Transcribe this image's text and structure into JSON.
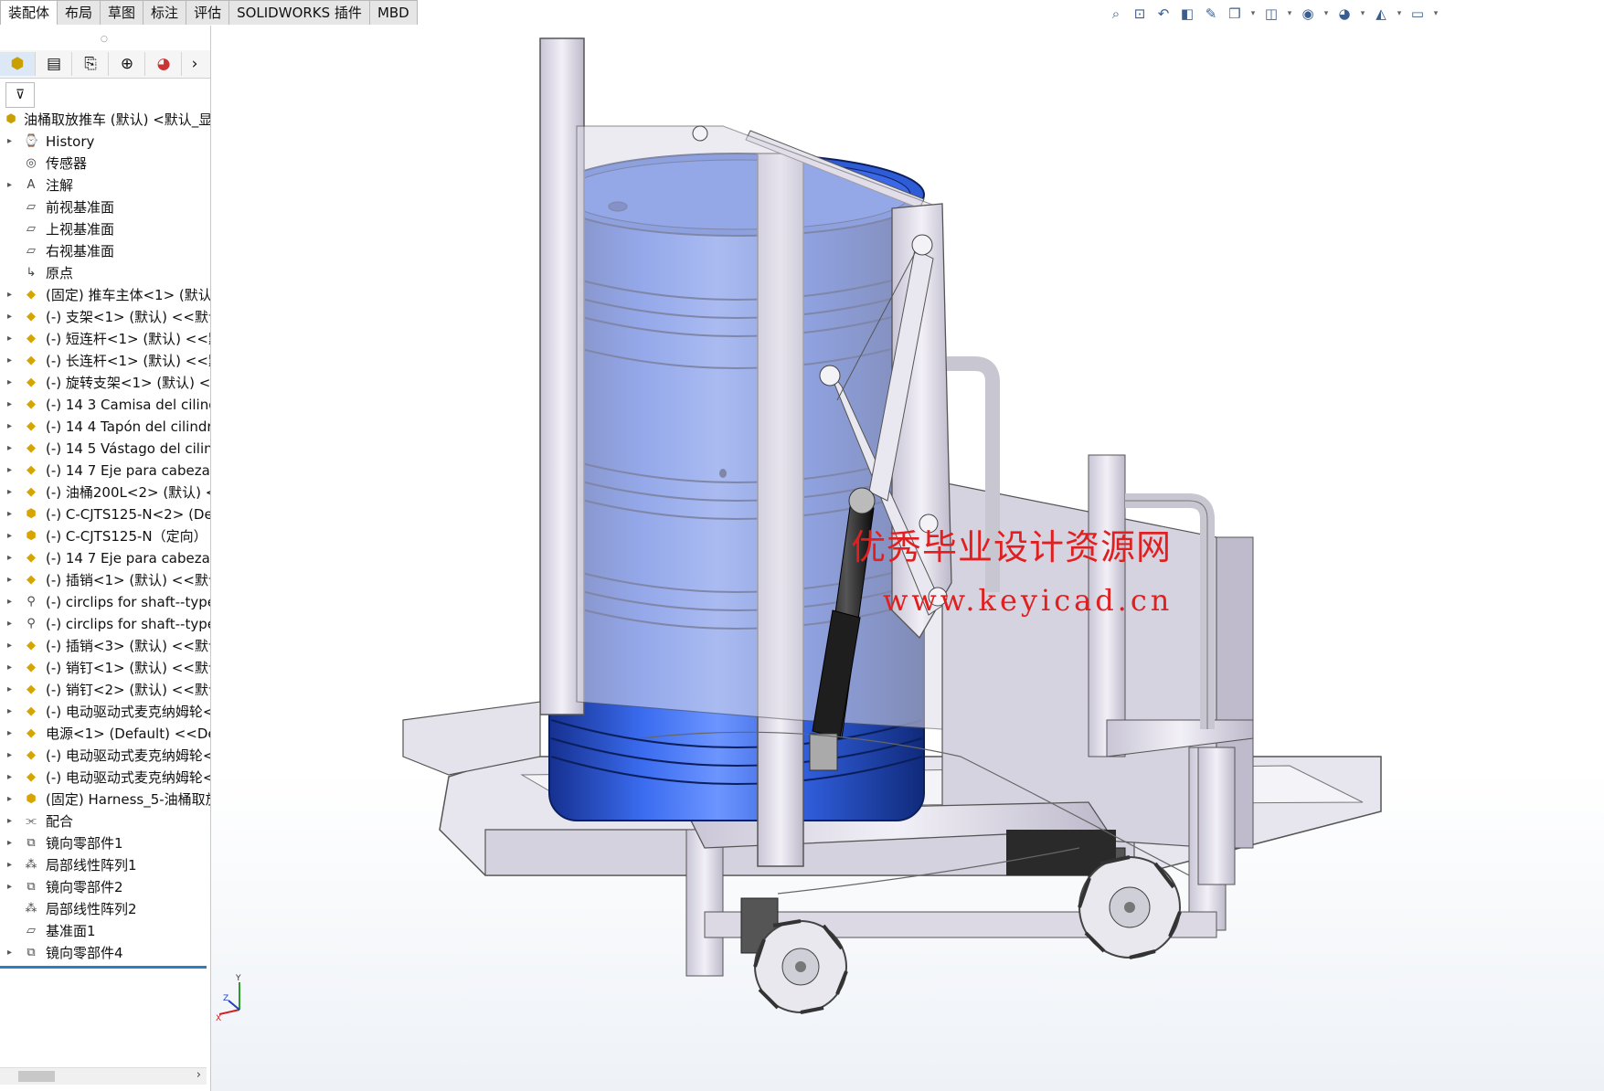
{
  "tabs": [
    "装配体",
    "布局",
    "草图",
    "标注",
    "评估",
    "SOLIDWORKS 插件",
    "MBD"
  ],
  "manager_tabs": [
    "featuremanager-icon",
    "propertymanager-icon",
    "configurationmanager-icon",
    "dimxpert-icon",
    "display-manager-icon"
  ],
  "tree": {
    "root": "油桶取放推车 (默认) <默认_显",
    "items": [
      {
        "label": "History",
        "icon": "history-icon",
        "expandable": true
      },
      {
        "label": "传感器",
        "icon": "sensor-icon",
        "expandable": false
      },
      {
        "label": "注解",
        "icon": "annotation-icon",
        "expandable": true
      },
      {
        "label": "前视基准面",
        "icon": "plane-icon",
        "expandable": false
      },
      {
        "label": "上视基准面",
        "icon": "plane-icon",
        "expandable": false
      },
      {
        "label": "右视基准面",
        "icon": "plane-icon",
        "expandable": false
      },
      {
        "label": "原点",
        "icon": "origin-icon",
        "expandable": false
      },
      {
        "label": "(固定) 推车主体<1> (默认) <",
        "icon": "part-icon",
        "expandable": true
      },
      {
        "label": "(-) 支架<1> (默认) <<默认",
        "icon": "part-icon",
        "expandable": true
      },
      {
        "label": "(-) 短连杆<1> (默认) <<默",
        "icon": "part-icon",
        "expandable": true
      },
      {
        "label": "(-) 长连杆<1> (默认) <<默",
        "icon": "part-icon",
        "expandable": true
      },
      {
        "label": "(-) 旋转支架<1> (默认) <<",
        "icon": "part-icon",
        "expandable": true
      },
      {
        "label": "(-) 14 3 Camisa del cilindr",
        "icon": "part-icon",
        "expandable": true
      },
      {
        "label": "(-) 14 4 Tapón del cilindr",
        "icon": "part-icon",
        "expandable": true
      },
      {
        "label": "(-) 14 5 Vástago del cilinc",
        "icon": "part-icon",
        "expandable": true
      },
      {
        "label": "(-) 14 7 Eje para cabezal c",
        "icon": "part-icon",
        "expandable": true
      },
      {
        "label": "(-) 油桶200L<2> (默认) <<",
        "icon": "part-icon",
        "expandable": true
      },
      {
        "label": "(-) C-CJTS125-N<2> (Def",
        "icon": "subassembly-icon",
        "expandable": true
      },
      {
        "label": "(-) C-CJTS125-N（定向）",
        "icon": "subassembly-icon",
        "expandable": true
      },
      {
        "label": "(-) 14 7 Eje para cabezal c",
        "icon": "part-icon",
        "expandable": true
      },
      {
        "label": "(-) 插销<1> (默认) <<默认",
        "icon": "part-icon",
        "expandable": true
      },
      {
        "label": "(-) circlips for shaft--type",
        "icon": "toolbox-icon",
        "expandable": true
      },
      {
        "label": "(-) circlips for shaft--type",
        "icon": "toolbox-icon",
        "expandable": true
      },
      {
        "label": "(-) 插销<3> (默认) <<默认",
        "icon": "part-icon",
        "expandable": true
      },
      {
        "label": "(-) 销钉<1> (默认) <<默认",
        "icon": "part-icon",
        "expandable": true
      },
      {
        "label": "(-) 销钉<2> (默认) <<默认",
        "icon": "part-icon",
        "expandable": true
      },
      {
        "label": "(-) 电动驱动式麦克纳姆轮<",
        "icon": "part-icon",
        "expandable": true
      },
      {
        "label": "电源<1> (Default) <<Def",
        "icon": "part-icon",
        "expandable": true
      },
      {
        "label": "(-) 电动驱动式麦克纳姆轮<",
        "icon": "part-icon",
        "expandable": true
      },
      {
        "label": "(-) 电动驱动式麦克纳姆轮<",
        "icon": "part-icon",
        "expandable": true
      },
      {
        "label": "(固定) Harness_5-油桶取放",
        "icon": "harness-icon",
        "expandable": true
      },
      {
        "label": "配合",
        "icon": "mates-icon",
        "expandable": true
      },
      {
        "label": "镜向零部件1",
        "icon": "mirror-icon",
        "expandable": true
      },
      {
        "label": "局部线性阵列1",
        "icon": "pattern-icon",
        "expandable": true
      },
      {
        "label": "镜向零部件2",
        "icon": "mirror-icon",
        "expandable": true
      },
      {
        "label": "局部线性阵列2",
        "icon": "pattern-icon",
        "expandable": false
      },
      {
        "label": "基准面1",
        "icon": "plane-icon",
        "expandable": false
      },
      {
        "label": "镜向零部件4",
        "icon": "mirror-icon",
        "expandable": true
      }
    ]
  },
  "hud_icons": [
    "zoom-to-fit-icon",
    "zoom-to-area-icon",
    "previous-view-icon",
    "section-view-icon",
    "dynamic-annotation-icon",
    "view-orientation-icon",
    "display-style-icon",
    "hide-show-icon",
    "edit-appearance-icon",
    "apply-scene-icon",
    "view-settings-icon"
  ],
  "watermark": {
    "line1": "优秀毕业设计资源网",
    "line2": "www.keyicad.cn"
  },
  "triad": {
    "x": "X",
    "y": "Y",
    "z": "Z"
  },
  "colors": {
    "drum": "#2e5bd6",
    "frame": "#d9d6e3",
    "watermark": "#e02020",
    "selection": "#2a7dc9"
  }
}
